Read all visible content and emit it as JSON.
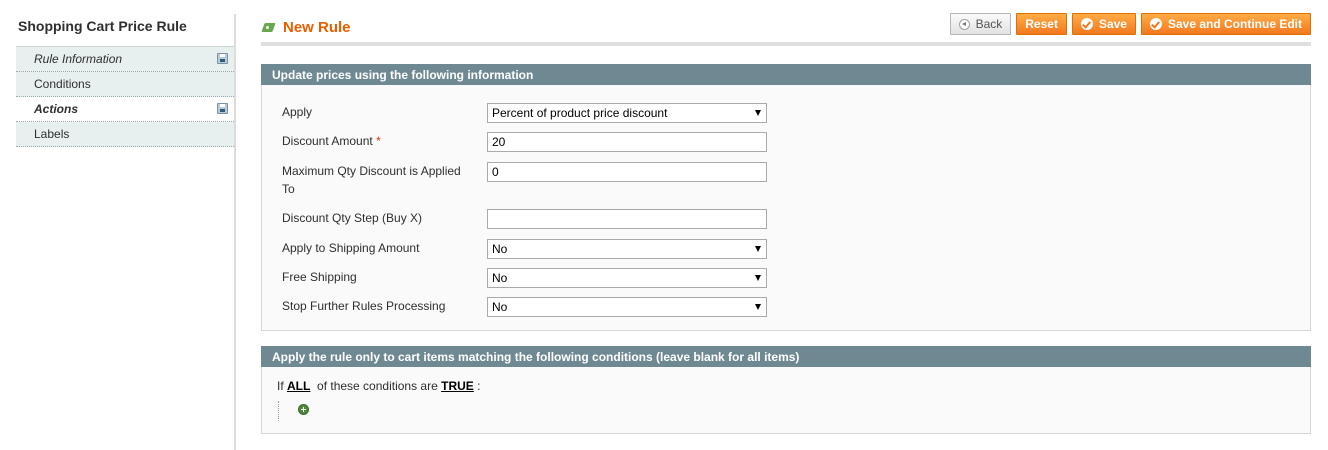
{
  "sidebar": {
    "title": "Shopping Cart Price Rule",
    "tabs": [
      {
        "label": "Rule Information"
      },
      {
        "label": "Conditions"
      },
      {
        "label": "Actions"
      },
      {
        "label": "Labels"
      }
    ]
  },
  "header": {
    "title": "New Rule",
    "buttons": {
      "back": "Back",
      "reset": "Reset",
      "save": "Save",
      "save_continue": "Save and Continue Edit"
    }
  },
  "actions_fieldset": {
    "legend": "Update prices using the following information",
    "fields": {
      "apply": {
        "label": "Apply",
        "value": "Percent of product price discount"
      },
      "discount_amount": {
        "label": "Discount Amount",
        "required_mark": "*",
        "value": "20"
      },
      "max_qty": {
        "label": "Maximum Qty Discount is Applied To",
        "value": "0"
      },
      "discount_step": {
        "label": "Discount Qty Step (Buy X)",
        "value": ""
      },
      "apply_shipping": {
        "label": "Apply to Shipping Amount",
        "value": "No"
      },
      "free_shipping": {
        "label": "Free Shipping",
        "value": "No"
      },
      "stop_rules": {
        "label": "Stop Further Rules Processing",
        "value": "No"
      }
    }
  },
  "conditions_fieldset": {
    "legend": "Apply the rule only to cart items matching the following conditions (leave blank for all items)",
    "prefix": "If",
    "aggregator": "ALL",
    "middle": "of these conditions are",
    "value": "TRUE",
    "suffix": ":"
  },
  "colors": {
    "accent": "#eb5e00",
    "button": "#f2781f",
    "legend_bg": "#6f8992"
  }
}
